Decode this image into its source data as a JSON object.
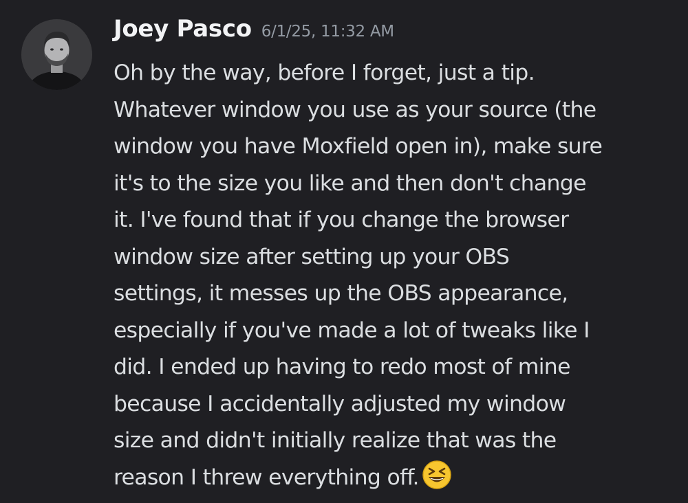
{
  "author": {
    "name": "Joey Pasco"
  },
  "timestamp": "6/1/25, 11:32 AM",
  "message": {
    "lines": [
      "Oh by the way, before I forget, just a tip.",
      "Whatever window you use as your source (the",
      "window you have Moxfield open in), make sure",
      "it's to the size you like and then don't change",
      "it. I've found that if you change the browser",
      "window size after setting up your OBS",
      "settings, it messes up the OBS appearance,",
      "especially if you've made a lot of tweaks like I",
      "did. I ended up having to redo most of mine",
      "because I accidentally adjusted my window",
      "size and didn't initially realize that was the",
      "reason I threw everything off."
    ],
    "trailing_emoji": "laughing-squinting-face-icon"
  },
  "colors": {
    "background": "#1f1f23",
    "author": "#f2f3f5",
    "timestamp": "#949ba4",
    "text": "#dbdee1",
    "emoji": "#f7c62f"
  }
}
